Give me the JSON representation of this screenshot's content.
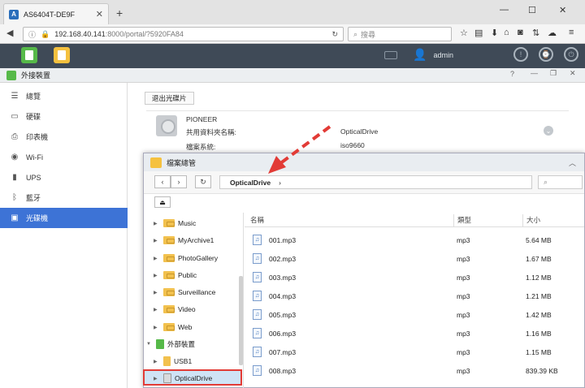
{
  "browser": {
    "tab_title": "AS6404T-DE9F",
    "url_host": "192.168.40.141",
    "url_rest": ":8000/portal/?5920FA84",
    "search_placeholder": "搜尋"
  },
  "adm": {
    "username": "admin"
  },
  "window": {
    "title": "外接裝置"
  },
  "sidebar": {
    "items": [
      {
        "label": "總覽",
        "icon": "overview-icon"
      },
      {
        "label": "硬碟",
        "icon": "disk-icon"
      },
      {
        "label": "印表機",
        "icon": "printer-icon"
      },
      {
        "label": "Wi-Fi",
        "icon": "wifi-icon"
      },
      {
        "label": "UPS",
        "icon": "ups-icon"
      },
      {
        "label": "藍牙",
        "icon": "bluetooth-icon"
      },
      {
        "label": "光碟機",
        "icon": "optical-drive-icon"
      }
    ],
    "active_index": 6
  },
  "device": {
    "eject_label": "退出光碟片",
    "name": "PIONEER",
    "share_label": "共用資料夾名稱:",
    "share_value": "OpticalDrive",
    "fs_label": "檔案系統:",
    "fs_value": "iso9660"
  },
  "file_explorer": {
    "title": "檔案總管",
    "path": "OpticalDrive",
    "tree": [
      {
        "label": "Music"
      },
      {
        "label": "MyArchive1"
      },
      {
        "label": "PhotoGallery"
      },
      {
        "label": "Public"
      },
      {
        "label": "Surveillance"
      },
      {
        "label": "Video"
      },
      {
        "label": "Web"
      },
      {
        "label": "外部裝置"
      },
      {
        "label": "USB1"
      },
      {
        "label": "OpticalDrive"
      }
    ],
    "columns": {
      "name": "名稱",
      "type": "類型",
      "size": "大小"
    },
    "files": [
      {
        "name": "001.mp3",
        "type": "mp3",
        "size": "5.64 MB"
      },
      {
        "name": "002.mp3",
        "type": "mp3",
        "size": "1.67 MB"
      },
      {
        "name": "003.mp3",
        "type": "mp3",
        "size": "1.12 MB"
      },
      {
        "name": "004.mp3",
        "type": "mp3",
        "size": "1.21 MB"
      },
      {
        "name": "005.mp3",
        "type": "mp3",
        "size": "1.42 MB"
      },
      {
        "name": "006.mp3",
        "type": "mp3",
        "size": "1.16 MB"
      },
      {
        "name": "007.mp3",
        "type": "mp3",
        "size": "1.15 MB"
      },
      {
        "name": "008.mp3",
        "type": "mp3",
        "size": "839.39 KB"
      }
    ]
  },
  "colors": {
    "accent": "#3d73d6",
    "highlight_border": "#e23b36",
    "topbar": "#3f4a57"
  }
}
